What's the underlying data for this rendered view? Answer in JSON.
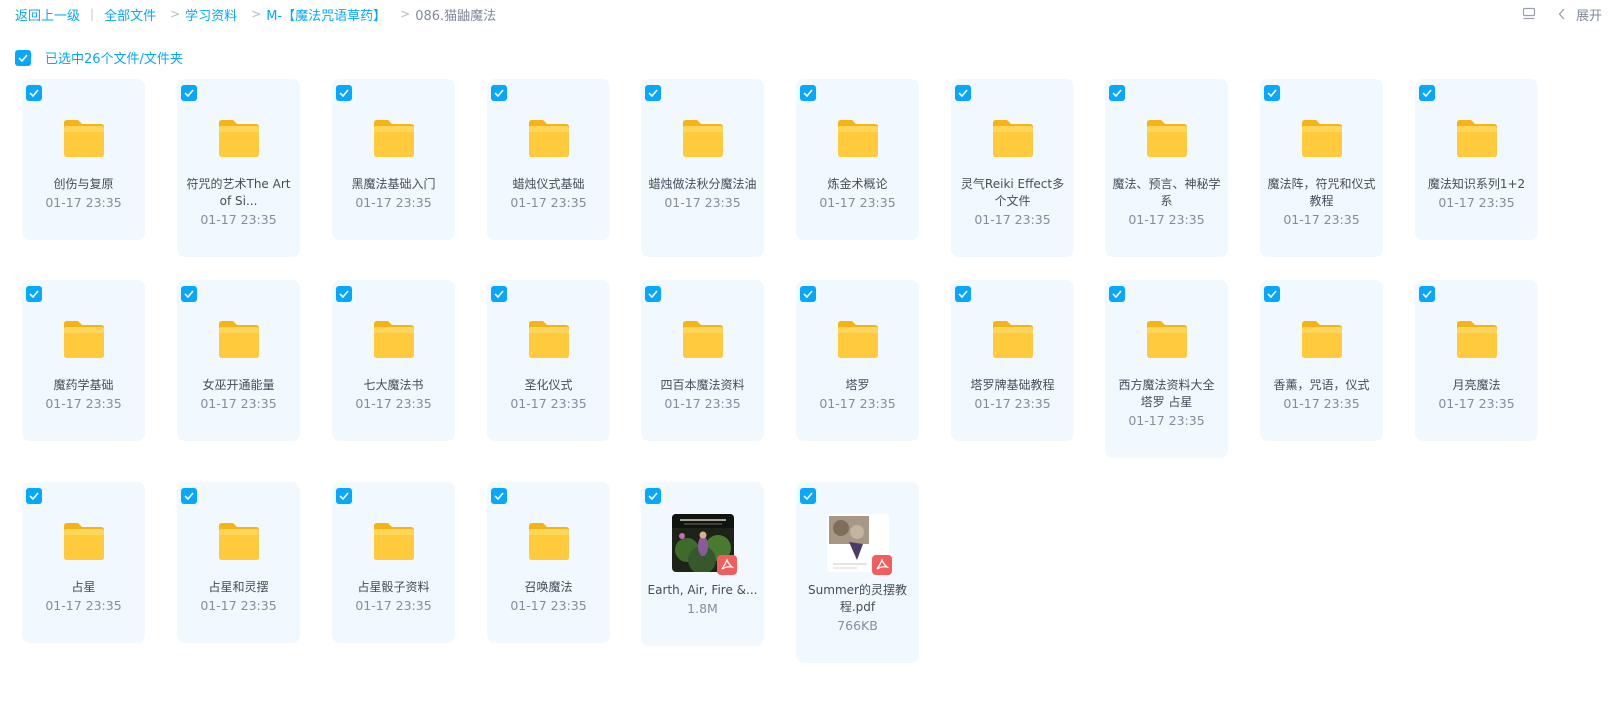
{
  "breadcrumb": {
    "back": "返回上一级",
    "items": [
      "全部文件",
      "学习资料",
      "M-【魔法咒语草药】"
    ],
    "current": "086.猫鼬魔法"
  },
  "toolbar": {
    "list_view_icon": "list-view-icon",
    "expand_label": "展开"
  },
  "selection": {
    "text": "已选中26个文件/文件夹"
  },
  "colors": {
    "accent": "#06a7ff",
    "card_bg": "#f1f8fe",
    "folder": "#ffc93b",
    "pdf_badge": "#f25d5d"
  },
  "files": [
    {
      "name": "创伤与复原",
      "date": "01-17 23:35",
      "type": "folder"
    },
    {
      "name": "符咒的艺术The Art of Si...",
      "date": "01-17 23:35",
      "type": "folder"
    },
    {
      "name": "黑魔法基础入门",
      "date": "01-17 23:35",
      "type": "folder"
    },
    {
      "name": "蜡烛仪式基础",
      "date": "01-17 23:35",
      "type": "folder"
    },
    {
      "name": "蜡烛做法秋分魔法油",
      "date": "01-17 23:35",
      "type": "folder"
    },
    {
      "name": "炼金术概论",
      "date": "01-17 23:35",
      "type": "folder"
    },
    {
      "name": "灵气Reiki Effect多个文件",
      "date": "01-17 23:35",
      "type": "folder"
    },
    {
      "name": "魔法、预言、神秘学系",
      "date": "01-17 23:35",
      "type": "folder"
    },
    {
      "name": "魔法阵，符咒和仪式教程",
      "date": "01-17 23:35",
      "type": "folder"
    },
    {
      "name": "魔法知识系列1+2",
      "date": "01-17 23:35",
      "type": "folder"
    },
    {
      "name": "魔药学基础",
      "date": "01-17 23:35",
      "type": "folder"
    },
    {
      "name": "女巫开通能量",
      "date": "01-17 23:35",
      "type": "folder"
    },
    {
      "name": "七大魔法书",
      "date": "01-17 23:35",
      "type": "folder"
    },
    {
      "name": "圣化仪式",
      "date": "01-17 23:35",
      "type": "folder"
    },
    {
      "name": "四百本魔法资料",
      "date": "01-17 23:35",
      "type": "folder"
    },
    {
      "name": "塔罗",
      "date": "01-17 23:35",
      "type": "folder"
    },
    {
      "name": "塔罗牌基础教程",
      "date": "01-17 23:35",
      "type": "folder"
    },
    {
      "name": "西方魔法资料大全 塔罗 占星",
      "date": "01-17 23:35",
      "type": "folder"
    },
    {
      "name": "香薰，咒语，仪式",
      "date": "01-17 23:35",
      "type": "folder"
    },
    {
      "name": "月亮魔法",
      "date": "01-17 23:35",
      "type": "folder"
    },
    {
      "name": "占星",
      "date": "01-17 23:35",
      "type": "folder"
    },
    {
      "name": "占星和灵摆",
      "date": "01-17 23:35",
      "type": "folder"
    },
    {
      "name": "占星骰子资料",
      "date": "01-17 23:35",
      "type": "folder"
    },
    {
      "name": "召唤魔法",
      "date": "01-17 23:35",
      "type": "folder"
    },
    {
      "name": "Earth, Air, Fire &...",
      "date": "1.8M",
      "type": "pdf"
    },
    {
      "name": "Summer的灵摆教程.pdf",
      "date": "766KB",
      "type": "pdf"
    }
  ]
}
